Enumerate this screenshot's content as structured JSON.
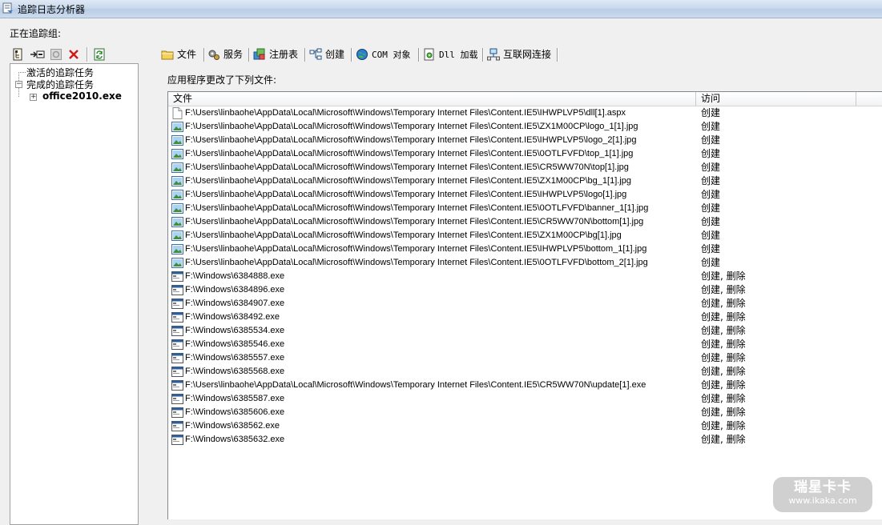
{
  "window": {
    "title": "追踪日志分析器"
  },
  "tracking_group_label": "正在追踪组:",
  "left_toolbar": {
    "buttons": [
      {
        "icon": "tree-view-icon"
      },
      {
        "icon": "expand-arrow-icon"
      },
      {
        "icon": "stop-icon"
      },
      {
        "icon": "delete-x-icon"
      },
      {
        "icon": "refresh-icon"
      }
    ]
  },
  "tree": {
    "active_tasks": "激活的追踪任务",
    "completed_tasks": "完成的追踪任务",
    "completed_child": "office2010.exe"
  },
  "tabs": [
    {
      "label": "文件",
      "icon": "folder-icon"
    },
    {
      "label": "服务",
      "icon": "gears-icon"
    },
    {
      "label": "注册表",
      "icon": "registry-icon"
    },
    {
      "label": "创建",
      "icon": "network-nodes-icon"
    },
    {
      "label": "COM 对象",
      "icon": "globe-icon"
    },
    {
      "label": "Dll 加载",
      "icon": "document-gear-icon"
    },
    {
      "label": "互联网连接",
      "icon": "network-computer-icon"
    }
  ],
  "description": "应用程序更改了下列文件:",
  "file_list": {
    "columns": [
      "文件",
      "访问"
    ],
    "rows": [
      {
        "icon": "blank-file-icon",
        "path": "F:\\Users\\linbaohe\\AppData\\Local\\Microsoft\\Windows\\Temporary Internet Files\\Content.IE5\\IHWPLVP5\\dll[1].aspx",
        "access": "创建"
      },
      {
        "icon": "image-file-icon",
        "path": "F:\\Users\\linbaohe\\AppData\\Local\\Microsoft\\Windows\\Temporary Internet Files\\Content.IE5\\ZX1M00CP\\logo_1[1].jpg",
        "access": "创建"
      },
      {
        "icon": "image-file-icon",
        "path": "F:\\Users\\linbaohe\\AppData\\Local\\Microsoft\\Windows\\Temporary Internet Files\\Content.IE5\\IHWPLVP5\\logo_2[1].jpg",
        "access": "创建"
      },
      {
        "icon": "image-file-icon",
        "path": "F:\\Users\\linbaohe\\AppData\\Local\\Microsoft\\Windows\\Temporary Internet Files\\Content.IE5\\0OTLFVFD\\top_1[1].jpg",
        "access": "创建"
      },
      {
        "icon": "image-file-icon",
        "path": "F:\\Users\\linbaohe\\AppData\\Local\\Microsoft\\Windows\\Temporary Internet Files\\Content.IE5\\CR5WW70N\\top[1].jpg",
        "access": "创建"
      },
      {
        "icon": "image-file-icon",
        "path": "F:\\Users\\linbaohe\\AppData\\Local\\Microsoft\\Windows\\Temporary Internet Files\\Content.IE5\\ZX1M00CP\\bg_1[1].jpg",
        "access": "创建"
      },
      {
        "icon": "image-file-icon",
        "path": "F:\\Users\\linbaohe\\AppData\\Local\\Microsoft\\Windows\\Temporary Internet Files\\Content.IE5\\IHWPLVP5\\logo[1].jpg",
        "access": "创建"
      },
      {
        "icon": "image-file-icon",
        "path": "F:\\Users\\linbaohe\\AppData\\Local\\Microsoft\\Windows\\Temporary Internet Files\\Content.IE5\\0OTLFVFD\\banner_1[1].jpg",
        "access": "创建"
      },
      {
        "icon": "image-file-icon",
        "path": "F:\\Users\\linbaohe\\AppData\\Local\\Microsoft\\Windows\\Temporary Internet Files\\Content.IE5\\CR5WW70N\\bottom[1].jpg",
        "access": "创建"
      },
      {
        "icon": "image-file-icon",
        "path": "F:\\Users\\linbaohe\\AppData\\Local\\Microsoft\\Windows\\Temporary Internet Files\\Content.IE5\\ZX1M00CP\\bg[1].jpg",
        "access": "创建"
      },
      {
        "icon": "image-file-icon",
        "path": "F:\\Users\\linbaohe\\AppData\\Local\\Microsoft\\Windows\\Temporary Internet Files\\Content.IE5\\IHWPLVP5\\bottom_1[1].jpg",
        "access": "创建"
      },
      {
        "icon": "image-file-icon",
        "path": "F:\\Users\\linbaohe\\AppData\\Local\\Microsoft\\Windows\\Temporary Internet Files\\Content.IE5\\0OTLFVFD\\bottom_2[1].jpg",
        "access": "创建"
      },
      {
        "icon": "exe-file-icon",
        "path": "F:\\Windows\\6384888.exe",
        "access": "创建, 删除"
      },
      {
        "icon": "exe-file-icon",
        "path": "F:\\Windows\\6384896.exe",
        "access": "创建, 删除"
      },
      {
        "icon": "exe-file-icon",
        "path": "F:\\Windows\\6384907.exe",
        "access": "创建, 删除"
      },
      {
        "icon": "exe-file-icon",
        "path": "F:\\Windows\\638492.exe",
        "access": "创建, 删除"
      },
      {
        "icon": "exe-file-icon",
        "path": "F:\\Windows\\6385534.exe",
        "access": "创建, 删除"
      },
      {
        "icon": "exe-file-icon",
        "path": "F:\\Windows\\6385546.exe",
        "access": "创建, 删除"
      },
      {
        "icon": "exe-file-icon",
        "path": "F:\\Windows\\6385557.exe",
        "access": "创建, 删除"
      },
      {
        "icon": "exe-file-icon",
        "path": "F:\\Windows\\6385568.exe",
        "access": "创建, 删除"
      },
      {
        "icon": "exe-file-icon",
        "path": "F:\\Users\\linbaohe\\AppData\\Local\\Microsoft\\Windows\\Temporary Internet Files\\Content.IE5\\CR5WW70N\\update[1].exe",
        "access": "创建, 删除"
      },
      {
        "icon": "exe-file-icon",
        "path": "F:\\Windows\\6385587.exe",
        "access": "创建, 删除"
      },
      {
        "icon": "exe-file-icon",
        "path": "F:\\Windows\\6385606.exe",
        "access": "创建, 删除"
      },
      {
        "icon": "exe-file-icon",
        "path": "F:\\Windows\\638562.exe",
        "access": "创建, 删除"
      },
      {
        "icon": "exe-file-icon",
        "path": "F:\\Windows\\6385632.exe",
        "access": "创建, 删除"
      }
    ]
  },
  "watermark": {
    "main": "瑞星卡卡",
    "sub": "www.ikaka.com"
  }
}
